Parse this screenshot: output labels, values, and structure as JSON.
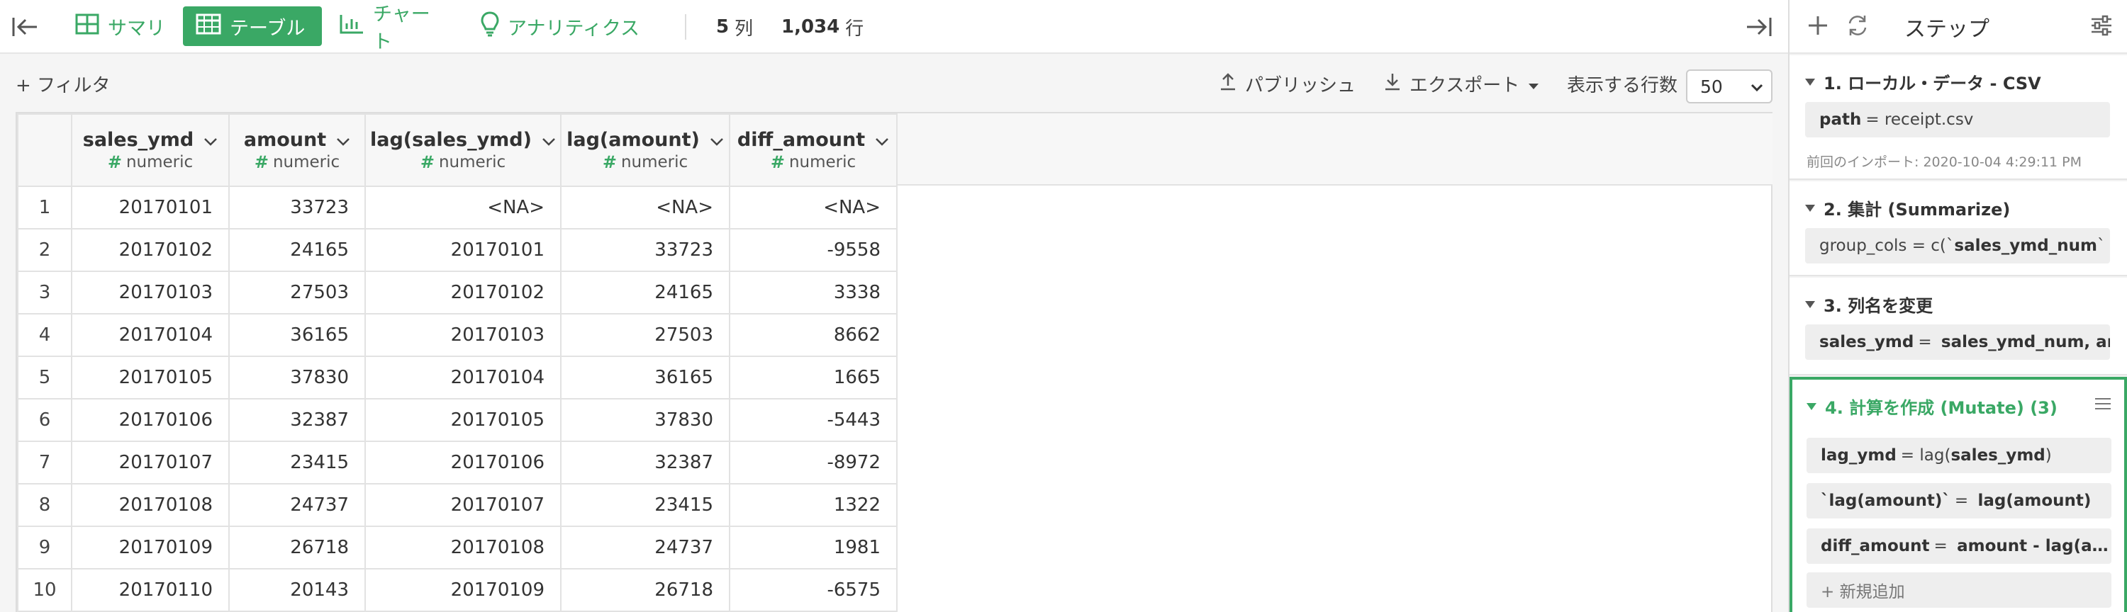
{
  "toolbar": {
    "tabs": [
      {
        "id": "summary",
        "label": "サマリ",
        "icon": "grid-icon"
      },
      {
        "id": "table",
        "label": "テーブル",
        "icon": "table-icon"
      },
      {
        "id": "chart",
        "label": "チャート",
        "icon": "bar-chart-icon"
      },
      {
        "id": "analytics",
        "label": "アナリティクス",
        "icon": "lightbulb-icon"
      }
    ],
    "active_tab": "table",
    "col_count": "5",
    "col_unit": "列",
    "row_count": "1,034",
    "row_unit": "行"
  },
  "actions": {
    "filter_label": "+ フィルタ",
    "publish_label": "パブリッシュ",
    "export_label": "エクスポート",
    "rows_label": "表示する行数",
    "rows_value": "50"
  },
  "table": {
    "columns": [
      {
        "name": "sales_ymd",
        "type": "numeric"
      },
      {
        "name": "amount",
        "type": "numeric"
      },
      {
        "name": "lag(sales_ymd)",
        "type": "numeric"
      },
      {
        "name": "lag(amount)",
        "type": "numeric"
      },
      {
        "name": "diff_amount",
        "type": "numeric"
      }
    ],
    "rows": [
      [
        "1",
        "20170101",
        "33723",
        "<NA>",
        "<NA>",
        "<NA>"
      ],
      [
        "2",
        "20170102",
        "24165",
        "20170101",
        "33723",
        "-9558"
      ],
      [
        "3",
        "20170103",
        "27503",
        "20170102",
        "24165",
        "3338"
      ],
      [
        "4",
        "20170104",
        "36165",
        "20170103",
        "27503",
        "8662"
      ],
      [
        "5",
        "20170105",
        "37830",
        "20170104",
        "36165",
        "1665"
      ],
      [
        "6",
        "20170106",
        "32387",
        "20170105",
        "37830",
        "-5443"
      ],
      [
        "7",
        "20170107",
        "23415",
        "20170106",
        "32387",
        "-8972"
      ],
      [
        "8",
        "20170108",
        "24737",
        "20170107",
        "23415",
        "1322"
      ],
      [
        "9",
        "20170109",
        "26718",
        "20170108",
        "24737",
        "1981"
      ],
      [
        "10",
        "20170110",
        "20143",
        "20170109",
        "26718",
        "-6575"
      ]
    ]
  },
  "side": {
    "title": "ステップ",
    "steps": [
      {
        "label": "1. ローカル・データ - CSV",
        "chip_key": "path",
        "chip_eq": "=",
        "chip_val": "receipt.csv",
        "meta": "前回のインポート: 2020-10-04 4:29:11 PM"
      },
      {
        "label": "2. 集計 (Summarize)",
        "chip_text": "group_cols = c(`",
        "chip_key": "sales_ymd_num",
        "chip_rest": "` = …"
      },
      {
        "label": "3. 列名を変更",
        "chip_key": "sales_ymd",
        "chip_eq": "=",
        "chip_val": "sales_ymd_num, am…"
      },
      {
        "label": "4. 計算を作成 (Mutate) (3)",
        "chips": [
          {
            "key": "lag_ymd",
            "eq": "=",
            "pre": "lag(",
            "arg": "sales_ymd",
            "post": ")"
          },
          {
            "key": "`lag(amount)`",
            "eq": "=",
            "pre": "",
            "arg": "lag(amount)",
            "post": ""
          },
          {
            "key": "diff_amount",
            "eq": "=",
            "pre": "",
            "arg": "amount - lag(a…",
            "post": ""
          }
        ],
        "add_label": "+ 新規追加"
      }
    ]
  },
  "colors": {
    "accent": "#3aa865"
  }
}
